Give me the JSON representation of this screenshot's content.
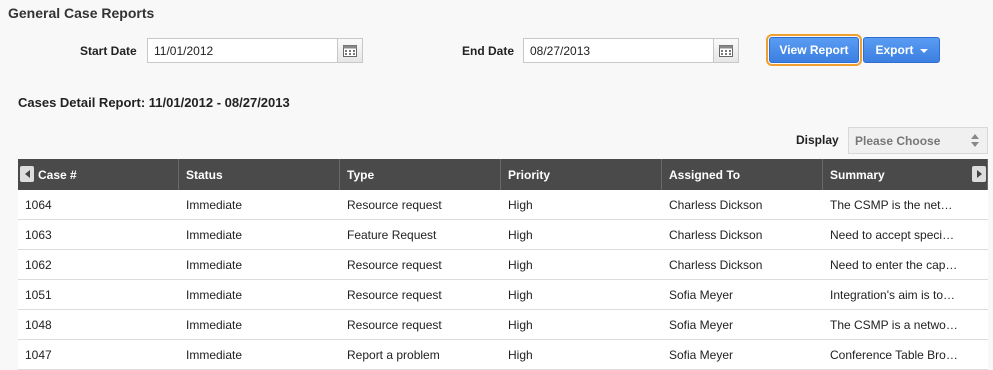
{
  "page": {
    "title": "General Case Reports"
  },
  "filters": {
    "start_label": "Start Date",
    "start_value": "11/01/2012",
    "end_label": "End Date",
    "end_value": "08/27/2013"
  },
  "actions": {
    "view_report_label": "View Report",
    "export_label": "Export"
  },
  "report": {
    "title": "Cases Detail Report: 11/01/2012 - 08/27/2013"
  },
  "display": {
    "label": "Display",
    "selected": "Please Choose"
  },
  "table": {
    "headers": [
      "Case #",
      "Status",
      "Type",
      "Priority",
      "Assigned To",
      "Summary"
    ],
    "rows": [
      [
        "1064",
        "Immediate",
        "Resource request",
        "High",
        "Charless Dickson",
        "The CSMP is the network management system"
      ],
      [
        "1063",
        "Immediate",
        "Feature Request",
        "High",
        "Charless Dickson",
        "Need to accept special requests"
      ],
      [
        "1062",
        "Immediate",
        "Resource request",
        "High",
        "Charless Dickson",
        "Need to enter the capacity"
      ],
      [
        "1051",
        "Immediate",
        "Resource request",
        "High",
        "Sofia Meyer",
        "Integration's aim is to connect"
      ],
      [
        "1048",
        "Immediate",
        "Resource request",
        "High",
        "Sofia Meyer",
        "The CSMP is a network system"
      ],
      [
        "1047",
        "Immediate",
        "Report a problem",
        "High",
        "Sofia Meyer",
        "Conference Table Broken"
      ]
    ]
  },
  "icons": {
    "calendar": "calendar-icon",
    "dropdown": "chevron-down-icon",
    "scroll_left": "arrow-left-icon",
    "scroll_right": "arrow-right-icon"
  },
  "colors": {
    "primary": "#4a8ef0",
    "focus_outline": "#f0a030",
    "grid_header": "#4a4a4a"
  }
}
